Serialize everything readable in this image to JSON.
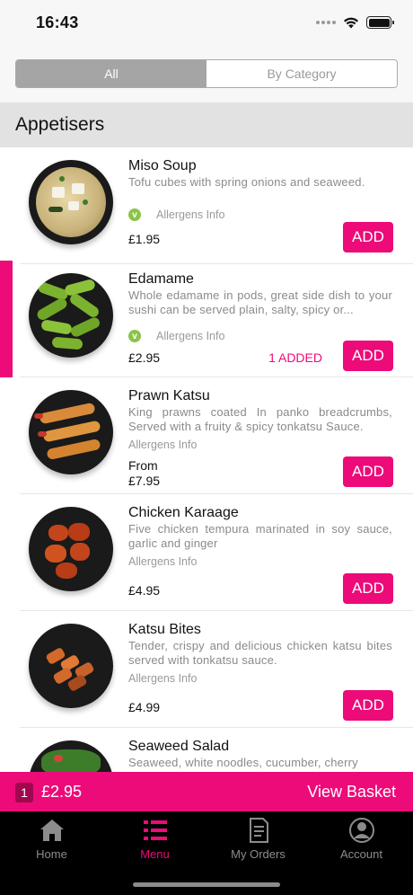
{
  "status": {
    "time": "16:43"
  },
  "segment": {
    "all_label": "All",
    "category_label": "By Category",
    "selected": "All"
  },
  "section": {
    "title": "Appetisers"
  },
  "items": [
    {
      "name": "Miso Soup",
      "desc": "Tofu cubes with spring onions and seaweed.",
      "allergen_label": "Allergens Info",
      "veg": true,
      "price_prefix": "",
      "price": "£1.95",
      "added": "",
      "add_label": "ADD"
    },
    {
      "name": "Edamame",
      "desc": "Whole edamame in pods, great side dish to your sushi can be served plain, salty, spicy or...",
      "allergen_label": "Allergens Info",
      "veg": true,
      "price_prefix": "",
      "price": "£2.95",
      "added": "1 ADDED",
      "add_label": "ADD"
    },
    {
      "name": "Prawn Katsu",
      "desc": "King prawns coated In panko breadcrumbs, Served with a fruity & spicy tonkatsu Sauce.",
      "allergen_label": "Allergens Info",
      "veg": false,
      "price_prefix": "From",
      "price": "£7.95",
      "added": "",
      "add_label": "ADD"
    },
    {
      "name": "Chicken Karaage",
      "desc": "Five chicken tempura marinated in soy sauce, garlic and ginger",
      "allergen_label": "Allergens Info",
      "veg": false,
      "price_prefix": "",
      "price": "£4.95",
      "added": "",
      "add_label": "ADD"
    },
    {
      "name": "Katsu Bites",
      "desc": "Tender, crispy and delicious chicken katsu bites served with tonkatsu sauce.",
      "allergen_label": "Allergens Info",
      "veg": false,
      "price_prefix": "",
      "price": "£4.99",
      "added": "",
      "add_label": "ADD"
    },
    {
      "name": "Seaweed Salad",
      "desc": "Seaweed, white noodles, cucumber, cherry",
      "allergen_label": "",
      "veg": false,
      "price_prefix": "",
      "price": "",
      "added": "",
      "add_label": ""
    }
  ],
  "basket": {
    "count": "1",
    "total": "£2.95",
    "view_label": "View Basket"
  },
  "tabs": [
    {
      "label": "Home",
      "icon": "home-icon",
      "active": false
    },
    {
      "label": "Menu",
      "icon": "menu-list-icon",
      "active": true
    },
    {
      "label": "My Orders",
      "icon": "receipt-icon",
      "active": false
    },
    {
      "label": "Account",
      "icon": "account-icon",
      "active": false
    }
  ],
  "colors": {
    "accent": "#ec0b79",
    "veg": "#8bc34a",
    "tab_bar": "#000000"
  }
}
